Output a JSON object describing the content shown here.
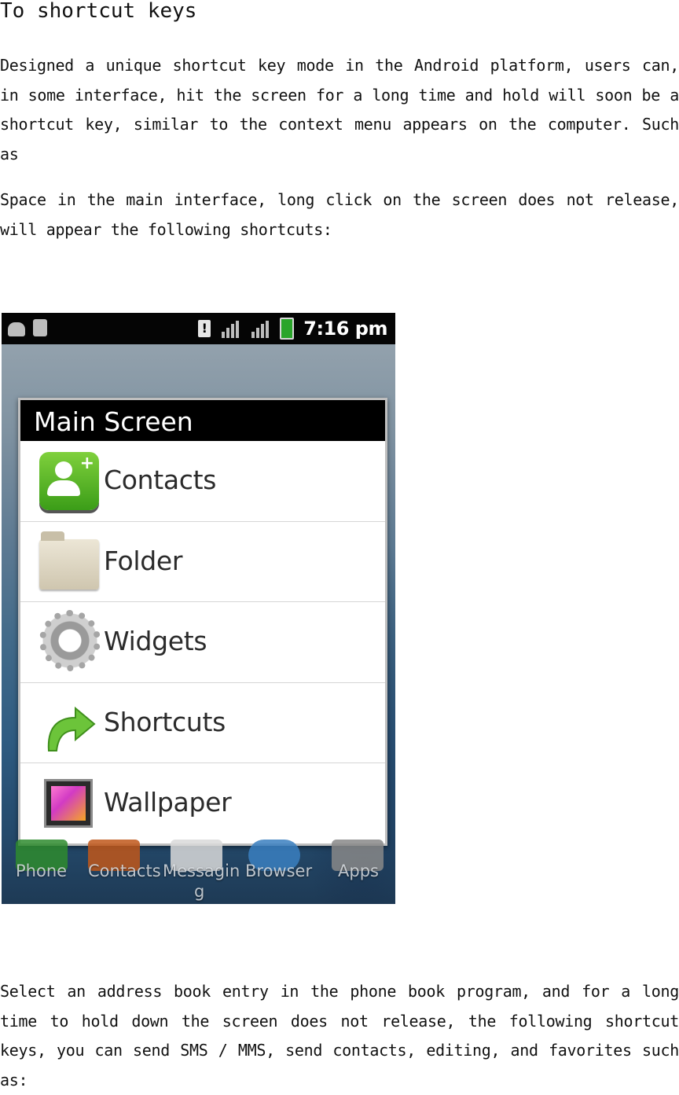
{
  "title": "To shortcut keys",
  "paragraphs": [
    "Designed a unique shortcut key mode in the Android platform, users can, in some interface, hit the screen for a long time and hold will soon be a shortcut key, similar to the context menu appears on the computer. Such as",
    "Space in the main interface, long click on the screen does not release, will appear the following shortcuts:",
    "Select an address book entry in the phone book program, and for a long time to hold down the screen does not release, the following shortcut keys, you can send SMS / MMS, send contacts, editing, and favorites such as:"
  ],
  "screenshot": {
    "status_bar": {
      "time": "7:16 pm",
      "alert_glyph": "!",
      "icons_left": [
        "android-debug-icon",
        "sd-card-icon"
      ],
      "icons_right": [
        "alert-icon",
        "signal-icon",
        "signal-icon",
        "battery-charging-icon"
      ]
    },
    "menu": {
      "title": "Main Screen",
      "items": [
        {
          "label": "Contacts",
          "icon": "contacts-icon",
          "plus": "+"
        },
        {
          "label": "Folder",
          "icon": "folder-icon"
        },
        {
          "label": "Widgets",
          "icon": "gear-icon"
        },
        {
          "label": "Shortcuts",
          "icon": "curved-arrow-icon"
        },
        {
          "label": "Wallpaper",
          "icon": "wallpaper-icon"
        }
      ]
    },
    "dock": [
      {
        "label": "Phone",
        "color": "#2e8b2e"
      },
      {
        "label": "Contacts",
        "color": "#c0571a"
      },
      {
        "label": "Messagin",
        "color": "#d9d9d9"
      },
      {
        "label": "Browser",
        "color": "#3a7fc0"
      },
      {
        "label": "Apps",
        "color": "#888888"
      }
    ],
    "dock_wrap_char": "g"
  }
}
